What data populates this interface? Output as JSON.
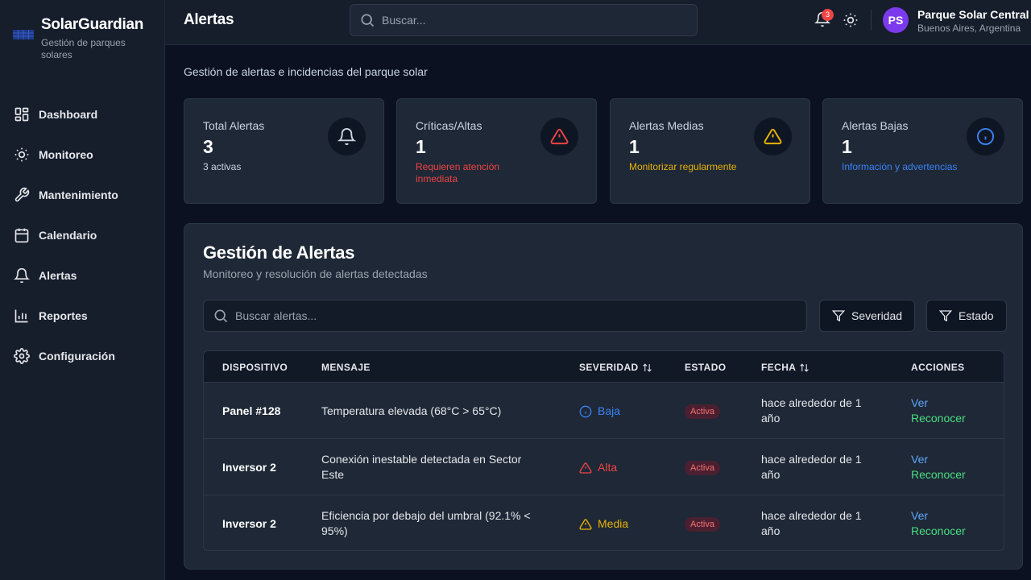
{
  "brand": {
    "name": "SolarGuardian",
    "subtitle": "Gestión de parques solares"
  },
  "sidebar": {
    "items": [
      {
        "label": "Dashboard",
        "icon": "dashboard-grid-icon"
      },
      {
        "label": "Monitoreo",
        "icon": "sun-icon"
      },
      {
        "label": "Mantenimiento",
        "icon": "wrench-icon"
      },
      {
        "label": "Calendario",
        "icon": "calendar-icon"
      },
      {
        "label": "Alertas",
        "icon": "bell-icon"
      },
      {
        "label": "Reportes",
        "icon": "bar-chart-icon"
      },
      {
        "label": "Configuración",
        "icon": "gear-icon"
      }
    ]
  },
  "header": {
    "title": "Alertas",
    "search_placeholder": "Buscar...",
    "notification_count": "3",
    "avatar_initials": "PS",
    "org_name": "Parque Solar Central",
    "org_location": "Buenos Aires, Argentina"
  },
  "page": {
    "subtitle": "Gestión de alertas e incidencias del parque solar"
  },
  "stats": [
    {
      "label": "Total Alertas",
      "value": "3",
      "note": "3 activas",
      "color": "#cbd5e1",
      "icon": "bell-icon"
    },
    {
      "label": "Críticas/Altas",
      "value": "1",
      "note": "Requieren atención inmediata",
      "color": "#ef4444",
      "icon": "alert-triangle-icon"
    },
    {
      "label": "Alertas Medias",
      "value": "1",
      "note": "Monitorizar regularmente",
      "color": "#eab308",
      "icon": "warning-triangle-icon"
    },
    {
      "label": "Alertas Bajas",
      "value": "1",
      "note": "Información y advertencias",
      "color": "#3b82f6",
      "icon": "info-icon"
    }
  ],
  "alerts_panel": {
    "title": "Gestión de Alertas",
    "subtitle": "Monitoreo y resolución de alertas detectadas",
    "search_placeholder": "Buscar alertas...",
    "filter_severity": "Severidad",
    "filter_status": "Estado",
    "columns": [
      "DISPOSITIVO",
      "MENSAJE",
      "SEVERIDAD",
      "ESTADO",
      "FECHA",
      "ACCIONES"
    ],
    "rows": [
      {
        "device": "Panel #128",
        "message": "Temperatura elevada (68°C > 65°C)",
        "severity": "Baja",
        "severity_color": "#3b82f6",
        "status": "Activa",
        "date": "hace alrededor de 1 año",
        "action_view": "Ver",
        "action_ack": "Reconocer"
      },
      {
        "device": "Inversor 2",
        "message": "Conexión inestable detectada en Sector Este",
        "severity": "Alta",
        "severity_color": "#ef4444",
        "status": "Activa",
        "date": "hace alrededor de 1 año",
        "action_view": "Ver",
        "action_ack": "Reconocer"
      },
      {
        "device": "Inversor 2",
        "message": "Eficiencia por debajo del umbral (92.1% < 95%)",
        "severity": "Media",
        "severity_color": "#eab308",
        "status": "Activa",
        "date": "hace alrededor de 1 año",
        "action_view": "Ver",
        "action_ack": "Reconocer"
      }
    ]
  }
}
